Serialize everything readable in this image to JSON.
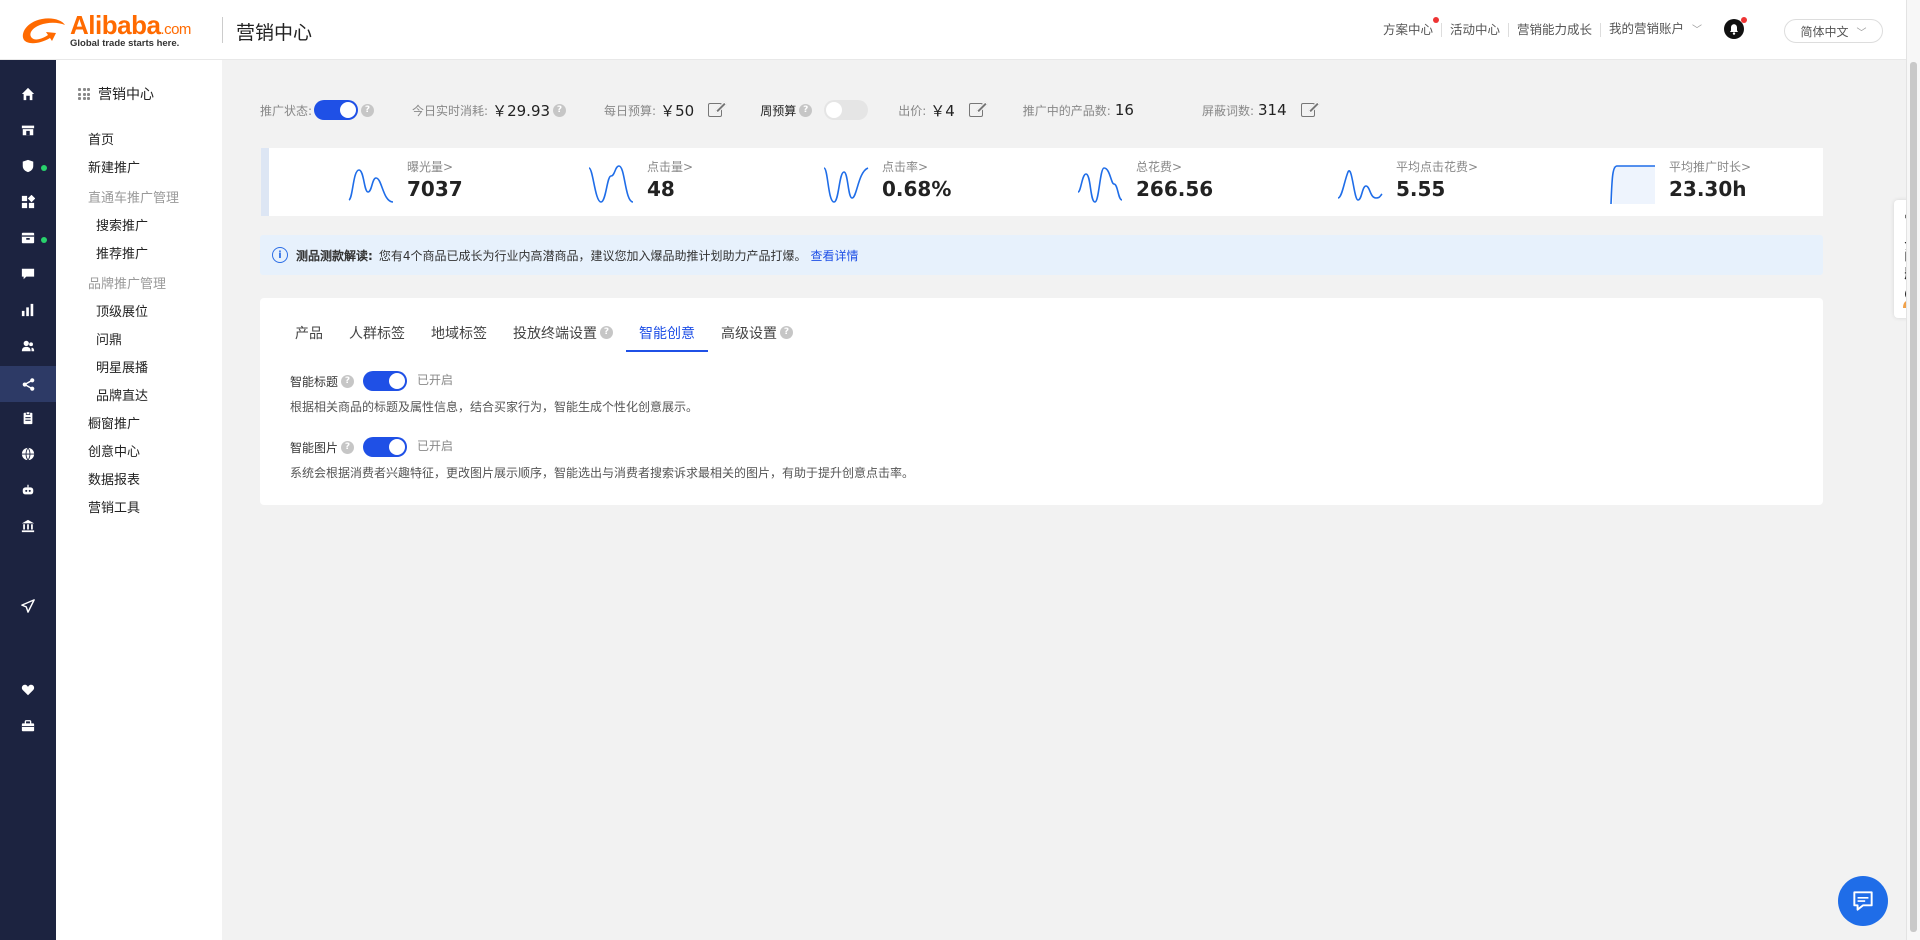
{
  "header": {
    "logo_word": "Alibaba",
    "logo_suffix": ".com",
    "logo_tagline": "Global trade starts here.",
    "app_title": "营销中心",
    "nav": [
      "方案中心",
      "活动中心",
      "营销能力成长",
      "我的营销账户"
    ],
    "language": "简体中文"
  },
  "sidebar": {
    "title": "营销中心",
    "items": [
      {
        "label": "首页",
        "kind": "item"
      },
      {
        "label": "新建推广",
        "kind": "item"
      },
      {
        "label": "直通车推广管理",
        "kind": "group"
      },
      {
        "label": "搜索推广",
        "kind": "sub"
      },
      {
        "label": "推荐推广",
        "kind": "sub"
      },
      {
        "label": "品牌推广管理",
        "kind": "group"
      },
      {
        "label": "顶级展位",
        "kind": "sub"
      },
      {
        "label": "问鼎",
        "kind": "sub"
      },
      {
        "label": "明星展播",
        "kind": "sub"
      },
      {
        "label": "品牌直达",
        "kind": "sub"
      },
      {
        "label": "橱窗推广",
        "kind": "item"
      },
      {
        "label": "创意中心",
        "kind": "item"
      },
      {
        "label": "数据报表",
        "kind": "item"
      },
      {
        "label": "营销工具",
        "kind": "item"
      }
    ]
  },
  "status": {
    "promo_status_label": "推广状态:",
    "today_spend_label": "今日实时消耗:",
    "today_spend_value": "￥29.93",
    "daily_budget_label": "每日预算:",
    "daily_budget_value": "￥50",
    "weekly_budget_label": "周预算",
    "bid_label": "出价:",
    "bid_value": "￥4",
    "products_label": "推广中的产品数:",
    "products_value": "16",
    "blocked_label": "屏蔽词数:",
    "blocked_value": "314"
  },
  "metrics": [
    {
      "label": "曝光量",
      "value": "7037"
    },
    {
      "label": "点击量",
      "value": "48"
    },
    {
      "label": "点击率",
      "value": "0.68%"
    },
    {
      "label": "总花费",
      "value": "266.56"
    },
    {
      "label": "平均点击花费",
      "value": "5.55"
    },
    {
      "label": "平均推广时长",
      "value": "23.30h"
    }
  ],
  "notice": {
    "title": "测品测款解读:",
    "text": "您有4个商品已成长为行业内高潜商品，建议您加入爆品助推计划助力产品打爆。",
    "link": "查看详情"
  },
  "tabs": [
    "产品",
    "人群标签",
    "地域标签",
    "投放终端设置",
    "智能创意",
    "高级设置"
  ],
  "active_tab": "智能创意",
  "settings": {
    "smart_title_label": "智能标题",
    "smart_title_state": "已开启",
    "smart_title_desc": "根据相关商品的标题及属性信息，结合买家行为，智能生成个性化创意展示。",
    "smart_image_label": "智能图片",
    "smart_image_state": "已开启",
    "smart_image_desc": "系统会根据消费者兴趣特征，更改图片展示顺序，智能选出与消费者搜索诉求最相关的图片，有助于提升创意点击率。"
  },
  "faq": [
    "常",
    "见",
    "问",
    "题"
  ],
  "colors": {
    "accent": "#1f50e6",
    "brand": "#ff6a00",
    "rail": "#1c2340"
  }
}
